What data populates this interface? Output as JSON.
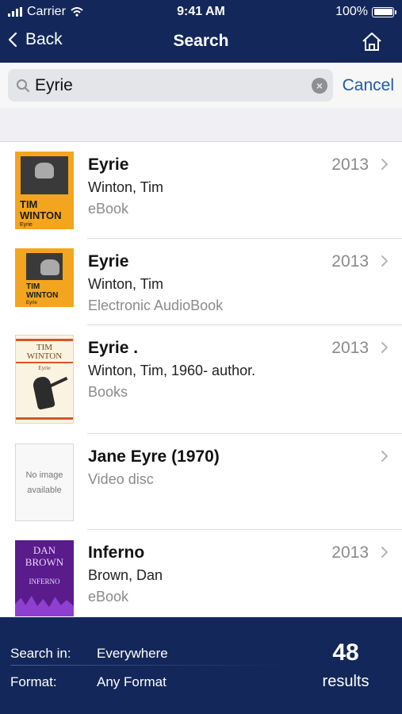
{
  "status": {
    "carrier": "Carrier",
    "time": "9:41 AM",
    "battery": "100%",
    "battery_level": 1.0
  },
  "nav": {
    "back_label": "Back",
    "title": "Search",
    "home_icon": "home-icon"
  },
  "search": {
    "value": "Eyrie",
    "placeholder": "",
    "cancel_label": "Cancel",
    "clear_icon": "clear-icon"
  },
  "results": [
    {
      "title": "Eyrie",
      "author": "Winton, Tim",
      "format": "eBook",
      "year": "2013",
      "cover_text": [
        "TIM",
        "WINTON",
        "Eyrie"
      ]
    },
    {
      "title": "Eyrie",
      "author": "Winton, Tim",
      "format": "Electronic AudioBook",
      "year": "2013",
      "cover_text": [
        "TIM",
        "WINTON",
        "Eyrie"
      ]
    },
    {
      "title": "Eyrie .",
      "author": "Winton, Tim, 1960- author.",
      "format": "Books",
      "year": "2013",
      "cover_text": [
        "TIM",
        "WINTON",
        "Eyrie"
      ]
    },
    {
      "title": "Jane Eyre (1970)",
      "author": "",
      "format": "Video disc",
      "year": "",
      "cover_text": [
        "No image",
        "available"
      ]
    },
    {
      "title": "Inferno",
      "author": "Brown, Dan",
      "format": "eBook",
      "year": "2013",
      "cover_text": [
        "DAN",
        "BROWN",
        "INFERNO"
      ]
    }
  ],
  "footer": {
    "search_in_label": "Search in:",
    "search_in_value": "Everywhere",
    "format_label": "Format:",
    "format_value": "Any Format",
    "count": "48",
    "count_label": "results"
  },
  "colors": {
    "navy": "#13275a",
    "accent": "#1f5aa6",
    "cover_orange": "#f3a51f",
    "cover_purple": "#5a1b8c"
  }
}
